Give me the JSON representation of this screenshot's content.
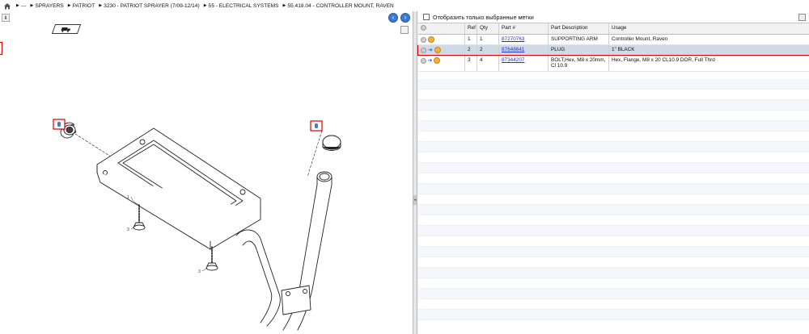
{
  "breadcrumb": {
    "items": [
      "---",
      "SPRAYERS",
      "PATRIOT",
      "3230 - PATRIOT SPRAYER (7/09-12/14)",
      "55 - ELECTRICAL SYSTEMS",
      "55.418.04 - CONTROLLER MOUNT, RAVEN"
    ]
  },
  "filter": {
    "label": "Отобразить только выбранные метки"
  },
  "table": {
    "headers": [
      "",
      "Ref",
      "Qty",
      "Part #",
      "Part Description",
      "Usage"
    ],
    "rows": [
      {
        "ref": "1",
        "qty": "1",
        "part": "87270763",
        "description": "SUPPORTING ARM",
        "usage": "Controller Mount, Raven",
        "selected": false
      },
      {
        "ref": "2",
        "qty": "2",
        "part": "87648641",
        "description": "PLUG",
        "usage": "1\" BLACK",
        "selected": true
      },
      {
        "ref": "3",
        "qty": "4",
        "part": "87344207",
        "description": "BOLT,Hex, M8 x 20mm, Cl 10.9",
        "usage": "Hex, Flange, M8 x 20 CL10.9 DOR, Full Thrd",
        "selected": false
      }
    ]
  },
  "diagram": {
    "callouts": [
      "1",
      "2",
      "3",
      "3"
    ]
  },
  "icons": {
    "home": "home-icon",
    "nav_back": "arrow-left-icon",
    "nav_forward": "arrow-right-icon",
    "highlight": "highlight-marker-icon",
    "row_info": "info-circle-icon",
    "row_cart": "cart-arrow-icon",
    "row_fav": "favorite-icon"
  },
  "colors": {
    "selection_border": "#dd0000",
    "selection_fill": "#d0d9e6",
    "link": "#2233cc",
    "nav_button": "#3a7bd5"
  }
}
